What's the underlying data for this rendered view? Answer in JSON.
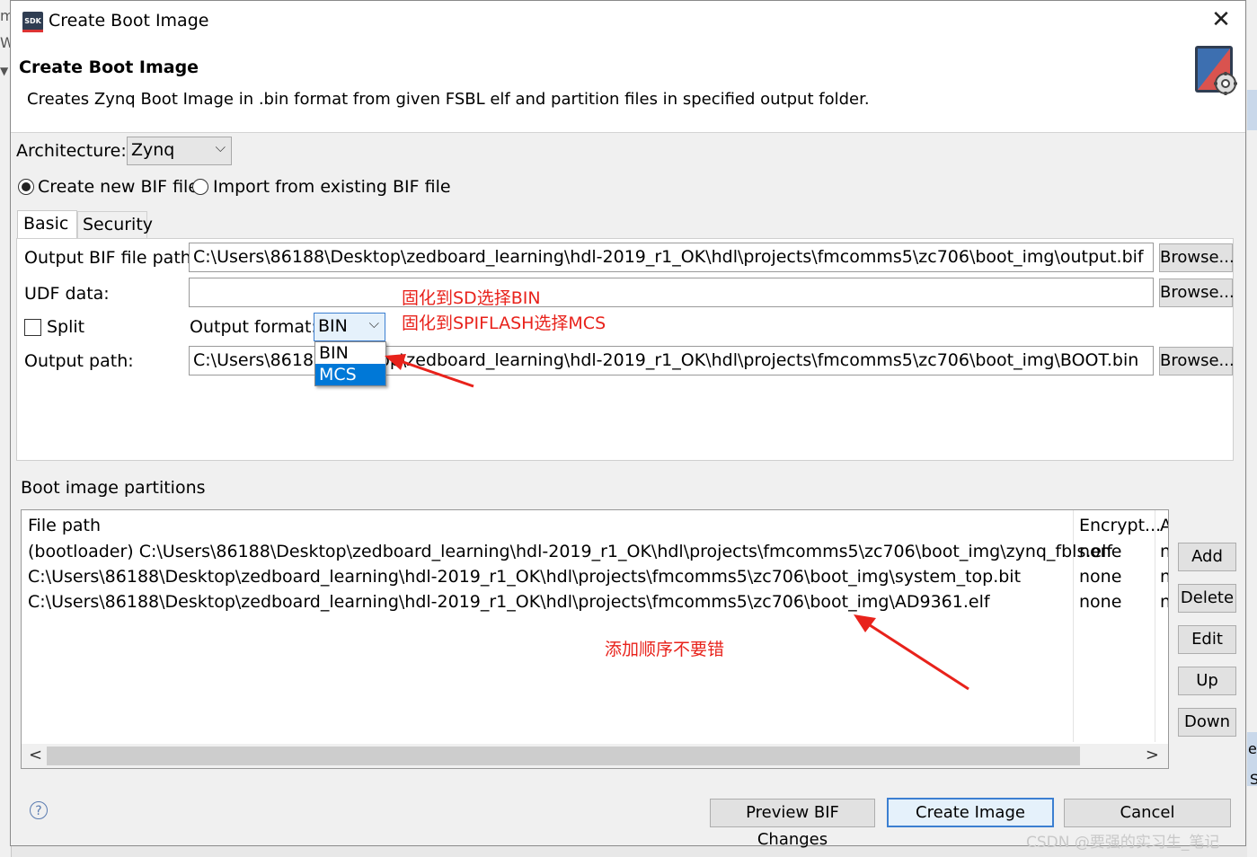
{
  "background": {
    "left_fragment_1": "m",
    "left_fragment_2": "Wi",
    "right_fragment_1": "e",
    "right_fragment_2": "S"
  },
  "window": {
    "title": "Create Boot Image",
    "icon_label": "SDK"
  },
  "header": {
    "title": "Create Boot Image",
    "description": "Creates Zynq Boot Image in .bin format from given FSBL elf and partition files in specified output folder."
  },
  "architecture": {
    "label": "Architecture:",
    "value": "Zynq"
  },
  "bif_mode": {
    "create_label": "Create new BIF file",
    "import_label": "Import from existing BIF file",
    "selected": "create"
  },
  "tabs": [
    {
      "label": "Basic"
    },
    {
      "label": "Security"
    }
  ],
  "basic": {
    "output_bif_label": "Output BIF file path:",
    "output_bif_value": "C:\\Users\\86188\\Desktop\\zedboard_learning\\hdl-2019_r1_OK\\hdl\\projects\\fmcomms5\\zc706\\boot_img\\output.bif",
    "udf_label": "UDF data:",
    "udf_value": "",
    "split_label": "Split",
    "output_format_label": "Output format:",
    "output_format_value": "BIN",
    "output_format_options": [
      "BIN",
      "MCS"
    ],
    "output_path_label": "Output path:",
    "output_path_value": "C:\\Users\\86188\\Desktop\\zedboard_learning\\hdl-2019_r1_OK\\hdl\\projects\\fmcomms5\\zc706\\boot_img\\BOOT.bin",
    "browse_label": "Browse..."
  },
  "partitions": {
    "section_label": "Boot image partitions",
    "columns": [
      "File path",
      "Encrypt...",
      "A"
    ],
    "rows": [
      {
        "path": "(bootloader) C:\\Users\\86188\\Desktop\\zedboard_learning\\hdl-2019_r1_OK\\hdl\\projects\\fmcomms5\\zc706\\boot_img\\zynq_fbls.elf",
        "encrypt": "none",
        "a": "n"
      },
      {
        "path": "C:\\Users\\86188\\Desktop\\zedboard_learning\\hdl-2019_r1_OK\\hdl\\projects\\fmcomms5\\zc706\\boot_img\\system_top.bit",
        "encrypt": "none",
        "a": "n"
      },
      {
        "path": "C:\\Users\\86188\\Desktop\\zedboard_learning\\hdl-2019_r1_OK\\hdl\\projects\\fmcomms5\\zc706\\boot_img\\AD9361.elf",
        "encrypt": "none",
        "a": "n"
      }
    ],
    "buttons": {
      "add": "Add",
      "delete": "Delete",
      "edit": "Edit",
      "up": "Up",
      "down": "Down"
    },
    "scroll_left": "<",
    "scroll_right": ">"
  },
  "footer": {
    "help": "?",
    "preview": "Preview BIF Changes",
    "create": "Create Image",
    "cancel": "Cancel"
  },
  "annotations": {
    "sd": "固化到SD选择BIN",
    "spiflash": "固化到SPIFLASH选择MCS",
    "order": "添加顺序不要错",
    "color": "#e8221b"
  },
  "watermark": "CSDN @要强的实习生_笔记"
}
